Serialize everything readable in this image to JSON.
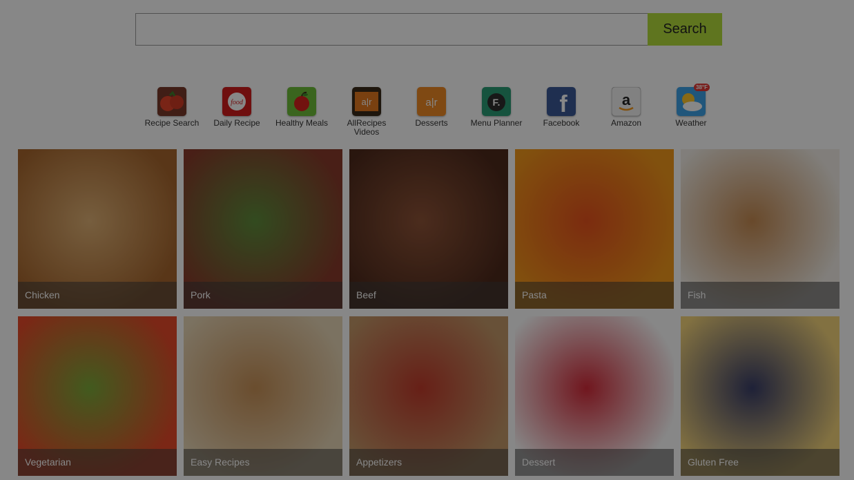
{
  "search": {
    "placeholder": "",
    "value": "",
    "button_label": "Search"
  },
  "apps": [
    {
      "label": "Recipe Search",
      "icon": "tomato-icon",
      "color": "#d9452b"
    },
    {
      "label": "Daily Recipe",
      "icon": "food-network-icon",
      "color": "#d21e1e",
      "icon_text": "food"
    },
    {
      "label": "Healthy Meals",
      "icon": "apple-icon",
      "color": "#6fbf3a"
    },
    {
      "label": "AllRecipes Videos",
      "icon": "film-icon",
      "color": "#e57a1f",
      "icon_text": "a|r"
    },
    {
      "label": "Desserts",
      "icon": "allrecipes-icon",
      "color": "#f08a24",
      "icon_text": "a|r"
    },
    {
      "label": "Menu Planner",
      "icon": "menu-planner-icon",
      "color": "#2a9d76",
      "icon_text": "F."
    },
    {
      "label": "Facebook",
      "icon": "facebook-icon",
      "color": "#3b5998",
      "icon_text": "f"
    },
    {
      "label": "Amazon",
      "icon": "amazon-icon",
      "color": "#f3f3f3",
      "icon_text": "a"
    },
    {
      "label": "Weather",
      "icon": "weather-icon",
      "color": "#3ea2e8",
      "badge": "38°F"
    }
  ],
  "categories": [
    {
      "label": "Chicken",
      "colors": [
        "#a8672e",
        "#e0b276"
      ]
    },
    {
      "label": "Pork",
      "colors": [
        "#8a3b2c",
        "#5f8e3c"
      ]
    },
    {
      "label": "Beef",
      "colors": [
        "#4e2a1c",
        "#8f5438"
      ]
    },
    {
      "label": "Pasta",
      "colors": [
        "#f49a1b",
        "#e9531e"
      ]
    },
    {
      "label": "Fish",
      "colors": [
        "#f3efe8",
        "#c68b52"
      ]
    },
    {
      "label": "Vegetarian",
      "colors": [
        "#e84a2a",
        "#7dab3a"
      ]
    },
    {
      "label": "Easy Recipes",
      "colors": [
        "#e9d8b8",
        "#c99258"
      ]
    },
    {
      "label": "Appetizers",
      "colors": [
        "#c49a6a",
        "#c23c2c"
      ]
    },
    {
      "label": "Dessert",
      "colors": [
        "#ffffff",
        "#d52b3a"
      ]
    },
    {
      "label": "Gluten Free",
      "colors": [
        "#f6d67c",
        "#3a3f6a"
      ]
    }
  ]
}
